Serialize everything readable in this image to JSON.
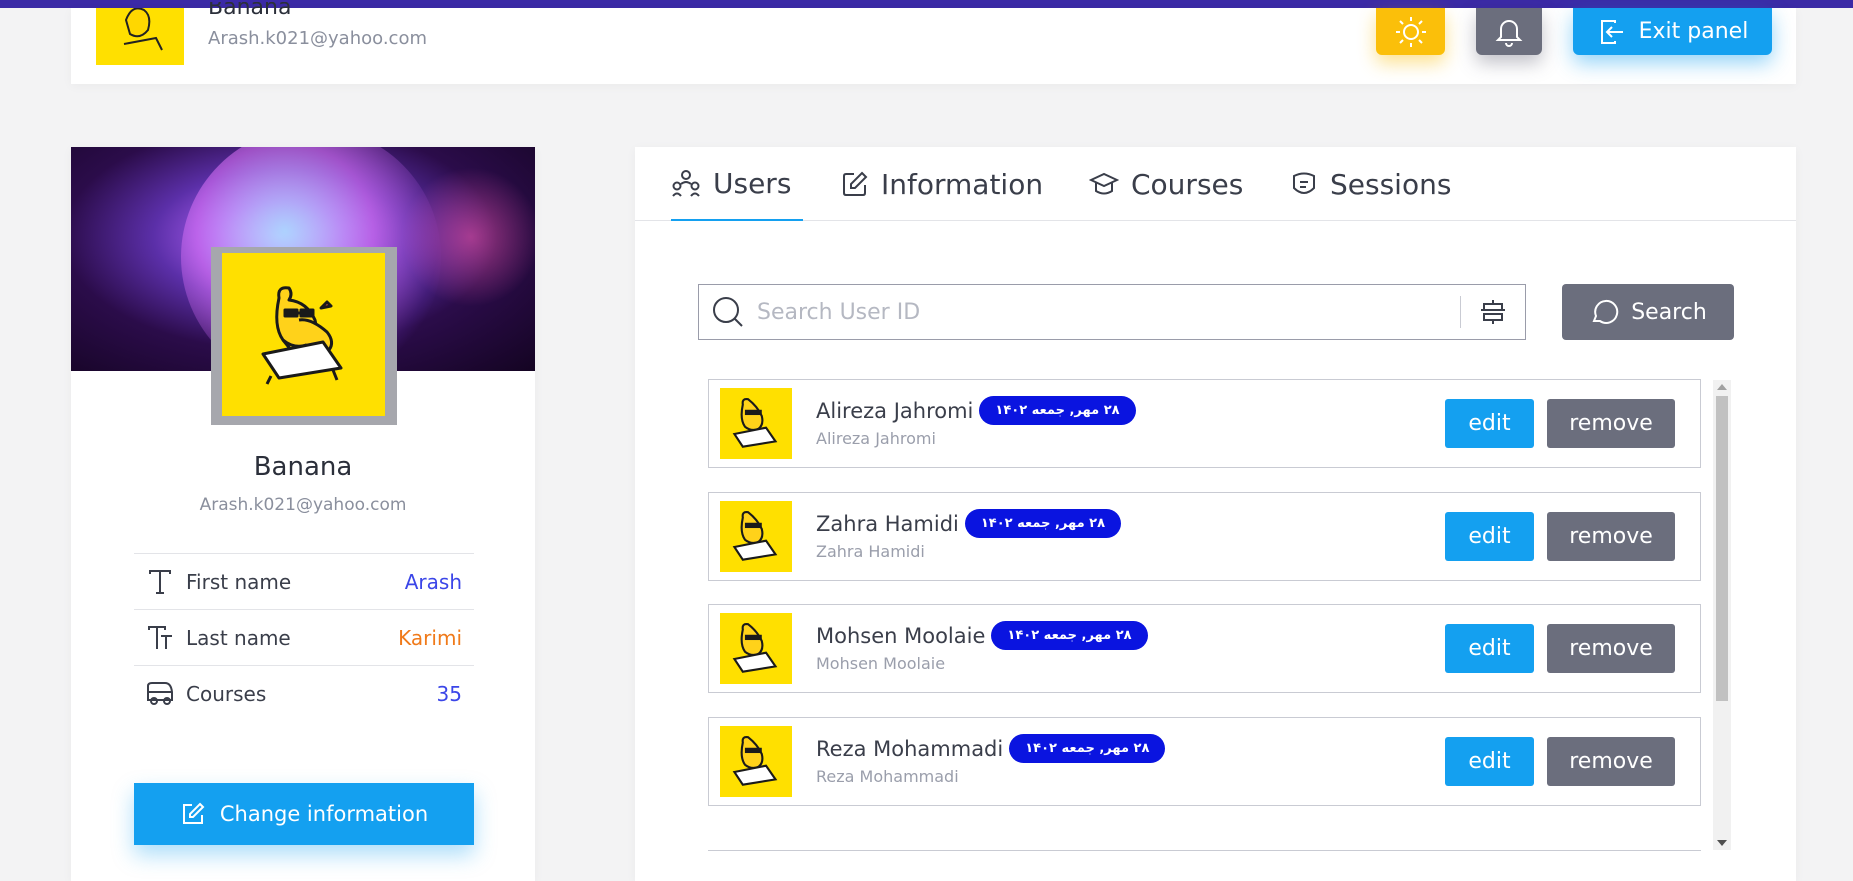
{
  "header": {
    "name": "Banana",
    "email": "Arash.k021@yahoo.com",
    "exit_label": "Exit panel"
  },
  "profile": {
    "name": "Banana",
    "email": "Arash.k021@yahoo.com",
    "rows": [
      {
        "label": "First name",
        "value": "Arash",
        "color": "#3b46e8"
      },
      {
        "label": "Last name",
        "value": "Karimi",
        "color": "#f07a1a"
      },
      {
        "label": "Courses",
        "value": "35",
        "color": "#3b46e8"
      }
    ],
    "change_label": "Change information"
  },
  "tabs": [
    {
      "label": "Users",
      "icon": "users-icon"
    },
    {
      "label": "Information",
      "icon": "edit-icon"
    },
    {
      "label": "Courses",
      "icon": "graduation-cap-icon"
    },
    {
      "label": "Sessions",
      "icon": "sessions-icon"
    }
  ],
  "search": {
    "placeholder": "Search User ID",
    "button_label": "Search"
  },
  "users": [
    {
      "name": "Alireza Jahromi",
      "sub": "Alireza Jahromi",
      "date": "۲۸ مهر, جمعه ۱۴۰۲",
      "edit": "edit",
      "remove": "remove"
    },
    {
      "name": "Zahra Hamidi",
      "sub": "Zahra Hamidi",
      "date": "۲۸ مهر, جمعه ۱۴۰۲",
      "edit": "edit",
      "remove": "remove"
    },
    {
      "name": "Mohsen Moolaie",
      "sub": "Mohsen Moolaie",
      "date": "۲۸ مهر, جمعه ۱۴۰۲",
      "edit": "edit",
      "remove": "remove"
    },
    {
      "name": "Reza Mohammadi",
      "sub": "Reza Mohammadi",
      "date": "۲۸ مهر, جمعه ۱۴۰۲",
      "edit": "edit",
      "remove": "remove"
    }
  ],
  "colors": {
    "accent": "#14a0f0",
    "top_strip": "#3b2aa6",
    "avatar_yellow": "#ffe000",
    "date_badge": "#0a14e0",
    "gray_button": "#6b6e7d"
  }
}
